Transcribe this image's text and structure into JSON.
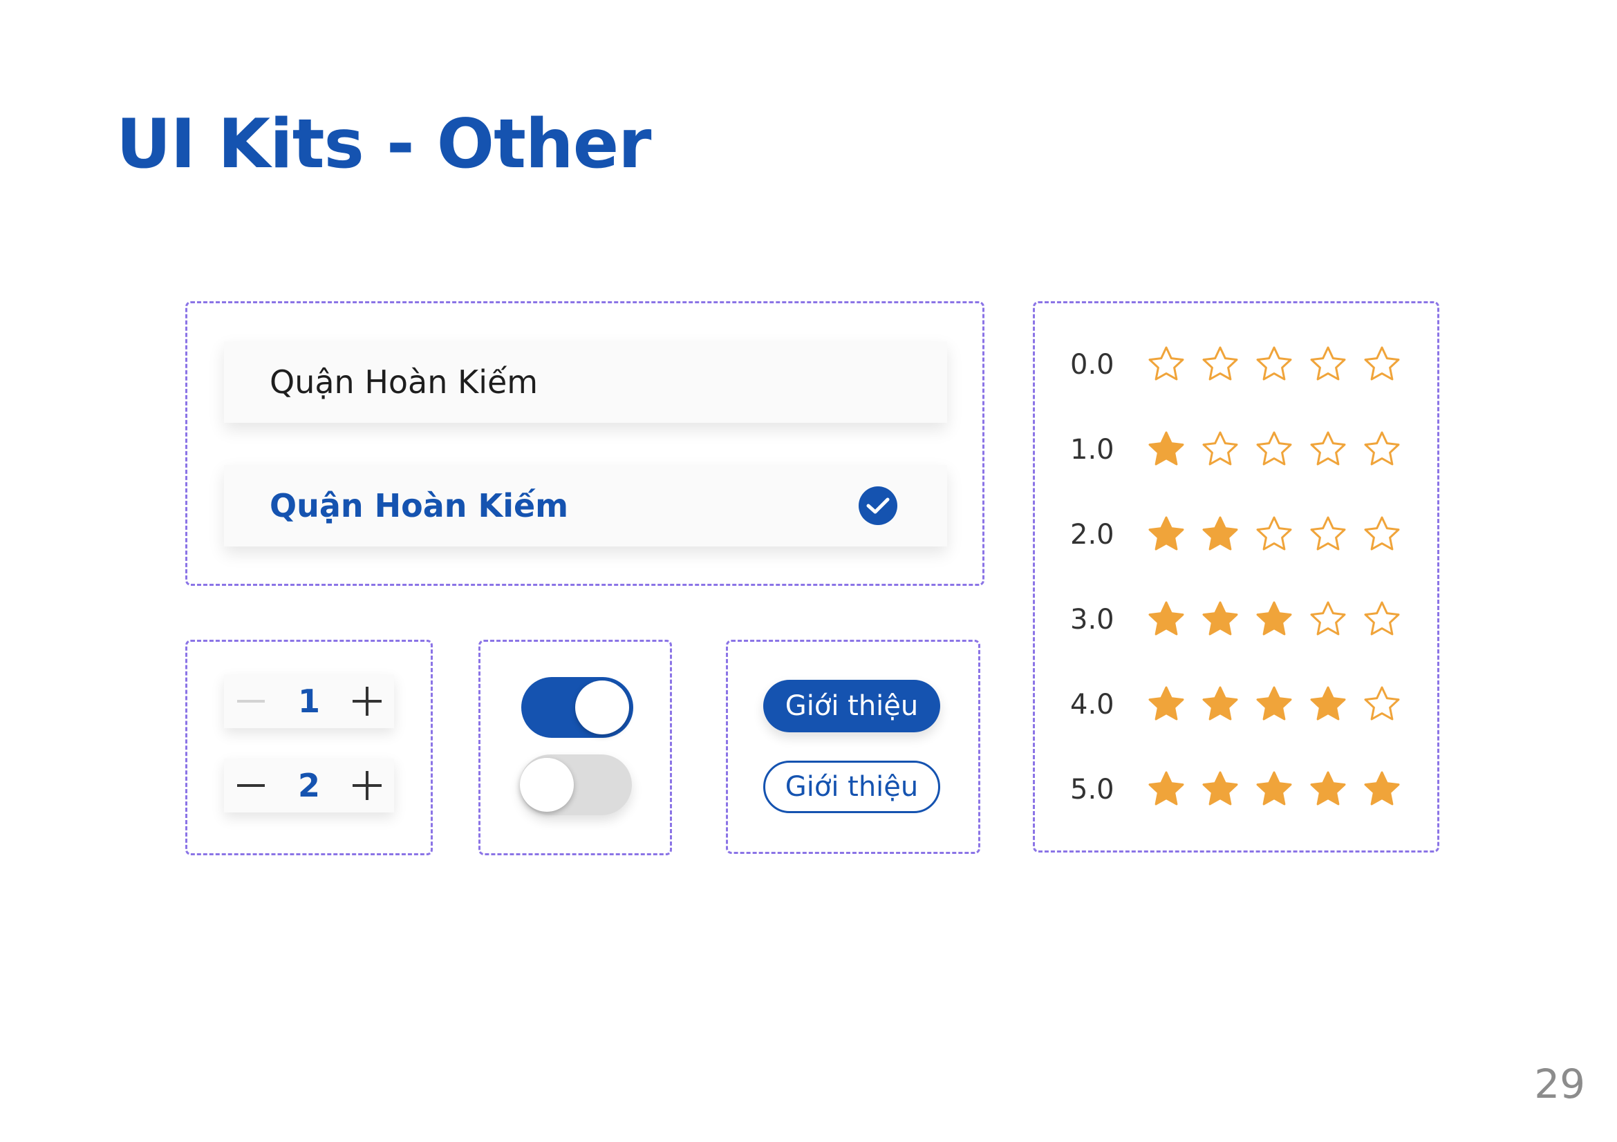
{
  "title": "UI Kits - Other",
  "page_number": "29",
  "colors": {
    "primary": "#1553b0",
    "star": "#f0a43a",
    "dash": "#8b74e6"
  },
  "list": {
    "items": [
      {
        "label": "Quận Hoàn Kiếm",
        "selected": false
      },
      {
        "label": "Quận Hoàn Kiếm",
        "selected": true,
        "icon": "check-circle-icon"
      }
    ]
  },
  "steppers": [
    {
      "value": "1",
      "minus_disabled": true
    },
    {
      "value": "2",
      "minus_disabled": false
    }
  ],
  "toggles": [
    {
      "state": "on"
    },
    {
      "state": "off"
    }
  ],
  "buttons": {
    "filled_label": "Giới thiệu",
    "outline_label": "Giới thiệu"
  },
  "ratings": [
    {
      "label": "0.0",
      "value": 0
    },
    {
      "label": "1.0",
      "value": 1
    },
    {
      "label": "2.0",
      "value": 2
    },
    {
      "label": "3.0",
      "value": 3
    },
    {
      "label": "4.0",
      "value": 4
    },
    {
      "label": "5.0",
      "value": 5
    }
  ],
  "rating_max": 5
}
